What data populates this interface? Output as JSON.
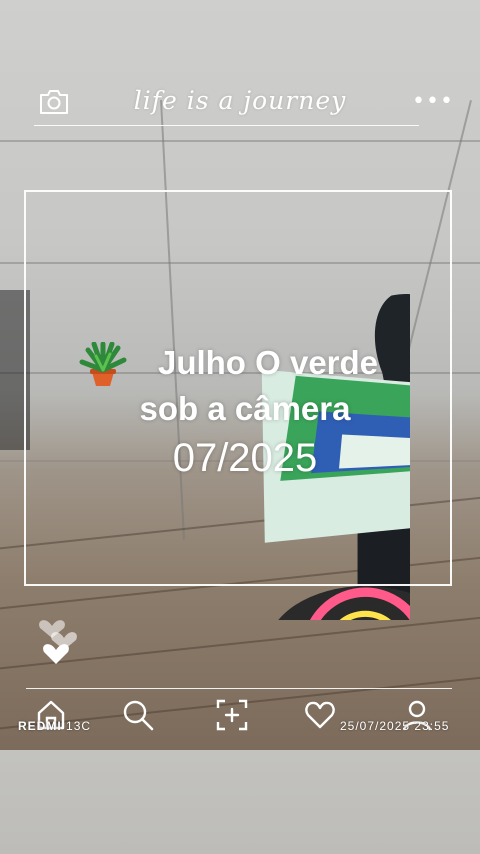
{
  "header": {
    "title": "life is a journey",
    "left_icon": "camera-icon",
    "right_icon": "more-horizontal-icon"
  },
  "post": {
    "caption_line1": "Julho O verde",
    "caption_line2": "sob a câmera",
    "caption_date": "07/2025",
    "emoji": "potted-plant-emoji"
  },
  "reactions": {
    "icon": "hearts-icon"
  },
  "bottom_nav": [
    {
      "name": "home-icon"
    },
    {
      "name": "search-icon"
    },
    {
      "name": "add-photo-icon"
    },
    {
      "name": "heart-icon"
    },
    {
      "name": "profile-icon"
    }
  ],
  "watermark": {
    "device_brand": "REDMI",
    "device_model": "13C",
    "datetime": "25/07/2025  23:55"
  },
  "colors": {
    "overlay": "#ffffff",
    "wall": "#c9c9c7",
    "floor": "#8a7868",
    "flag_green": "#3aa55a",
    "flag_blue": "#2f5fb5",
    "pot_orange": "#e5782f"
  }
}
